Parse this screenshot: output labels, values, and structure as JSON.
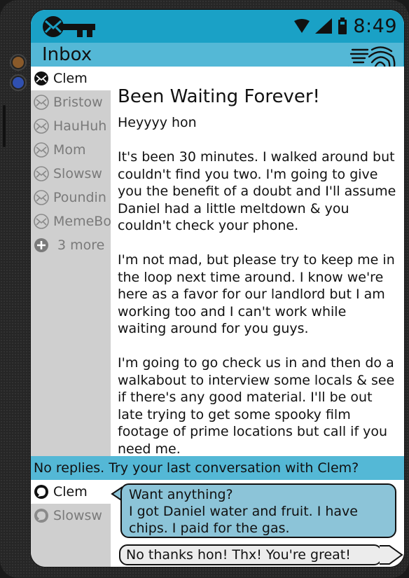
{
  "status": {
    "time": "8:49"
  },
  "header": {
    "title": "Inbox"
  },
  "sidebar": {
    "items": [
      {
        "label": "Clem",
        "active": true
      },
      {
        "label": "Bristow",
        "active": false
      },
      {
        "label": "HauHuh",
        "active": false
      },
      {
        "label": "Mom",
        "active": false
      },
      {
        "label": "Slowsw",
        "active": false
      },
      {
        "label": "Poundin",
        "active": false
      },
      {
        "label": "MemeBo",
        "active": false
      }
    ],
    "more_label": "3 more"
  },
  "email": {
    "subject": "Been Waiting Forever!",
    "greeting": "Heyyyy hon",
    "paragraphs": [
      "It's been 30 minutes.  I walked around but couldn't find you two.  I'm going to give you the benefit of a doubt and I'll assume Daniel had a little meltdown & you couldn't check your phone.",
      "I'm not mad, but please try to keep me in the loop next time around.  I know we're here as a favor for our landlord but I am working too and I can't work while waiting around for you guys.",
      "I'm going to go check us in and then do a walkabout to interview some locals & see if there's any good material.  I'll be out late trying to get some spooky film footage of prime locations but call if you need me."
    ]
  },
  "reply_bar": {
    "text": "No replies.  Try your last conversation with Clem?"
  },
  "chat": {
    "contacts": [
      {
        "label": "Clem",
        "active": true
      },
      {
        "label": "Slowsw",
        "active": false
      }
    ],
    "incoming_lines": [
      "Want anything?",
      "I got Daniel water and fruit. I have",
      "chips. I paid for the gas."
    ],
    "outgoing": "No thanks hon!  Thx!  You're great!"
  },
  "colors": {
    "accent": "#1aa1c6",
    "accent_light": "#54b8d6",
    "sidebar": "#cfcfcf",
    "bubble": "#8cc4d8"
  }
}
